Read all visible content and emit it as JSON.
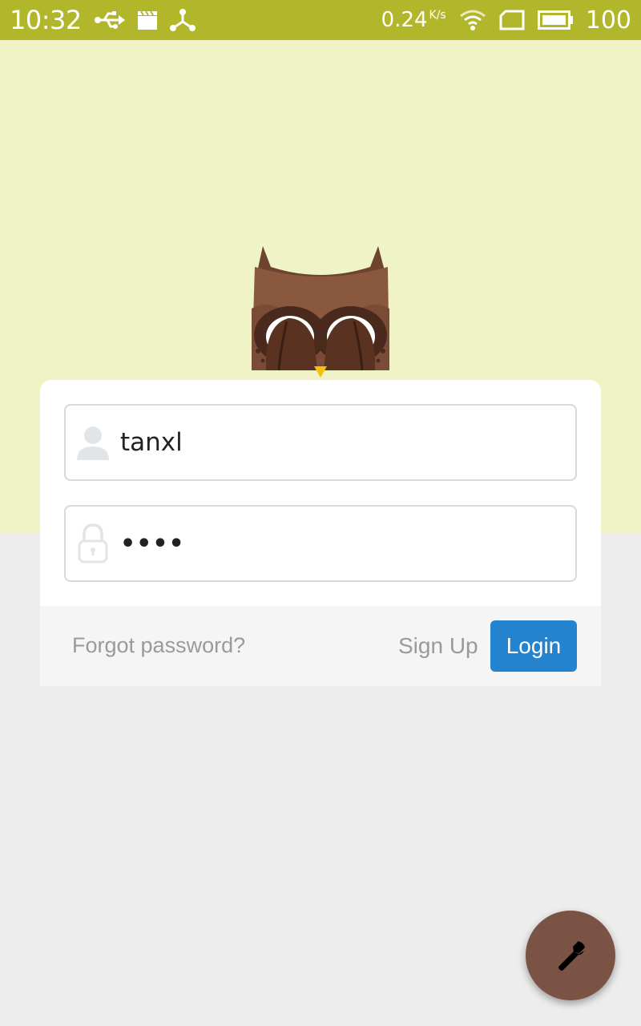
{
  "status_bar": {
    "time": "10:32",
    "net_speed": "0.24",
    "net_speed_unit": "K/s",
    "battery": "100",
    "color": "#B2B62B",
    "icons": [
      "usb-icon",
      "clapperboard-icon",
      "share-node-icon",
      "wifi-icon",
      "sim-card-icon",
      "battery-icon"
    ]
  },
  "header": {
    "color": "#F0F3C5",
    "mascot": "owl-covering-eyes"
  },
  "login_form": {
    "username": {
      "value": "tanxl",
      "icon": "user-icon"
    },
    "password": {
      "value": "••••",
      "icon": "lock-icon"
    },
    "forgot_label": "Forgot password?",
    "signup_label": "Sign Up",
    "login_label": "Login",
    "login_color": "#2383CE"
  },
  "fab": {
    "icon": "wrench-icon",
    "color": "#7A5345"
  }
}
